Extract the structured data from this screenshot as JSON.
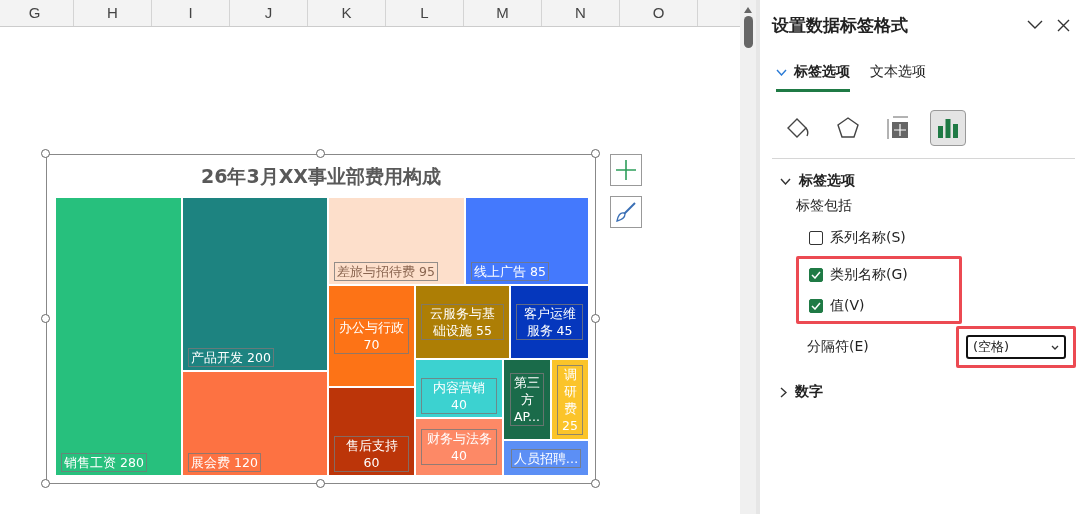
{
  "sheet": {
    "columns": [
      "G",
      "H",
      "I",
      "J",
      "K",
      "L",
      "M",
      "N",
      "O"
    ]
  },
  "chart": {
    "title": "26年3月XX事业部费用构成",
    "tiles": [
      {
        "label": "销售工资 280",
        "color": "#27c07d"
      },
      {
        "label": "产品开发 200",
        "color": "#1d8380"
      },
      {
        "label": "展会费 120",
        "color": "#fd7242"
      },
      {
        "label": "差旅与招待费 95",
        "color": "#fddfcb"
      },
      {
        "label": "线上广告 85",
        "color": "#4479fd"
      },
      {
        "label": "办公与行政 70",
        "color": "#fd7316"
      },
      {
        "label": "售后支持 60",
        "color": "#bc3509"
      },
      {
        "label": "云服务与基础设施 55",
        "color": "#ad7e05"
      },
      {
        "label": "客户运维服务 45",
        "color": "#0537bd"
      },
      {
        "label": "内容营销 40",
        "color": "#3cd2d0"
      },
      {
        "label": "财务与法务 40",
        "color": "#fd8966"
      },
      {
        "label": "第三方AP...",
        "color": "#1a6b4a"
      },
      {
        "label": "调研费 25",
        "color": "#fbc42a"
      },
      {
        "label": "人员招聘…",
        "color": "#5c8ff5"
      }
    ],
    "selected": true
  },
  "panel": {
    "title": "设置数据标签格式",
    "tabs": [
      {
        "label": "标签选项",
        "selected": true
      },
      {
        "label": "文本选项",
        "selected": false
      }
    ],
    "icon_tabs": [
      {
        "kind": "fill",
        "selected": false
      },
      {
        "kind": "shape",
        "selected": false
      },
      {
        "kind": "size",
        "selected": false
      },
      {
        "kind": "options",
        "selected": true
      }
    ],
    "sections": [
      {
        "title": "标签选项",
        "expanded": true,
        "subtitle": "标签包括",
        "checkboxes": [
          {
            "label": "系列名称(S)",
            "checked": false,
            "highlighted": false
          },
          {
            "label": "类别名称(G)",
            "checked": true,
            "highlighted": true
          },
          {
            "label": "值(V)",
            "checked": true,
            "highlighted": true
          }
        ],
        "separator": {
          "label": "分隔符(E)",
          "value": "(空格)",
          "highlighted": true
        }
      },
      {
        "title": "数字",
        "expanded": false
      }
    ]
  }
}
